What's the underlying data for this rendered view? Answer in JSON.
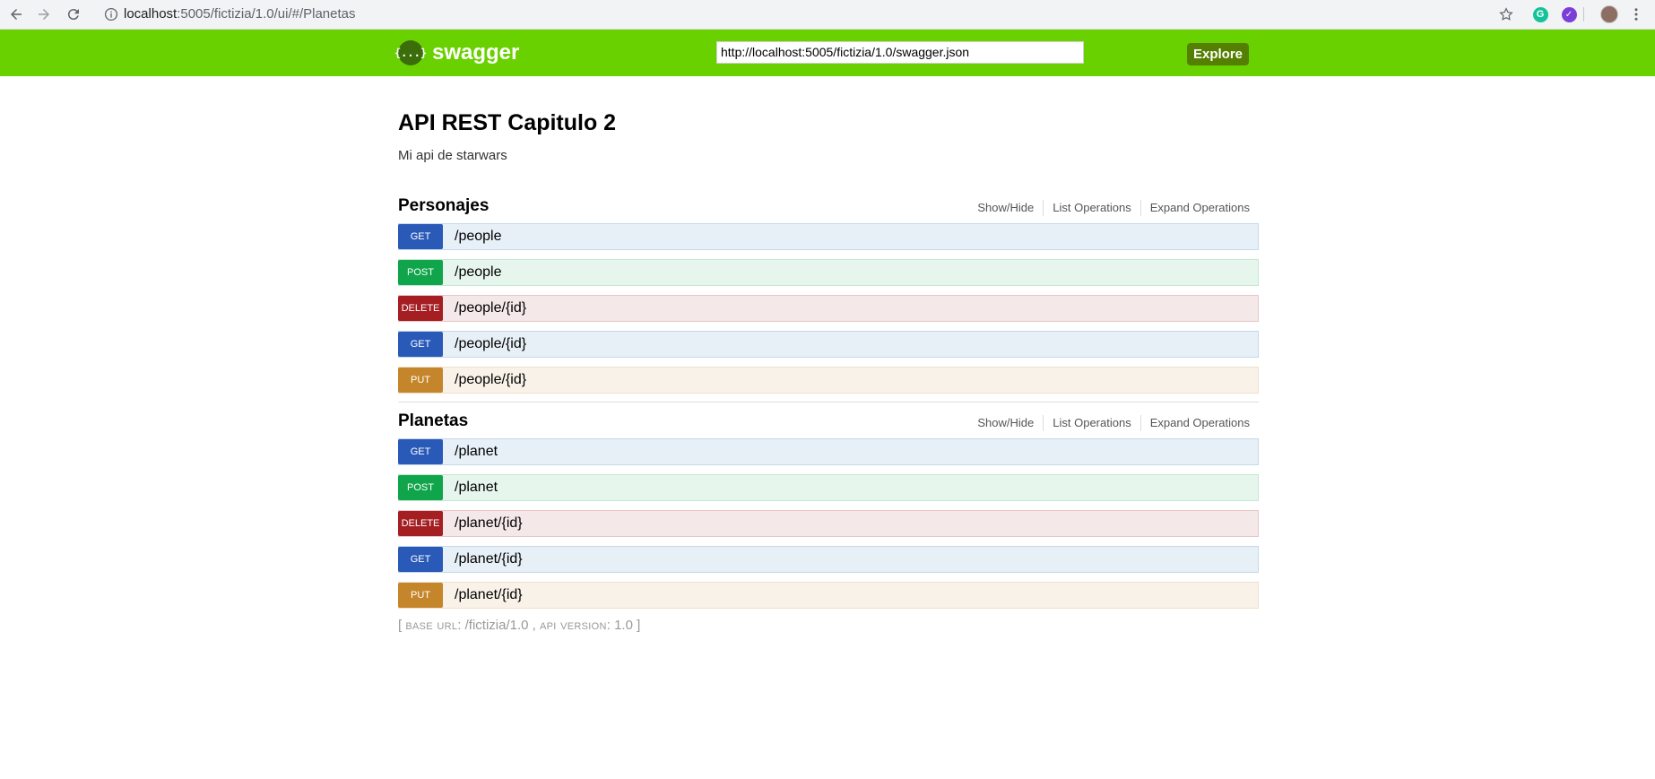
{
  "browser": {
    "url_host": "localhost",
    "url_path": ":5005/fictizia/1.0/ui/#/Planetas"
  },
  "header": {
    "logo_text": "swagger",
    "logo_icon": "{...}",
    "spec_url": "http://localhost:5005/fictizia/1.0/swagger.json",
    "explore_label": "Explore"
  },
  "info": {
    "title": "API REST Capitulo 2",
    "description": "Mi api de starwars"
  },
  "resources": [
    {
      "name": "Personajes",
      "ops_labels": [
        "Show/Hide",
        "List Operations",
        "Expand Operations"
      ],
      "operations": [
        {
          "method": "GET",
          "path": "/people"
        },
        {
          "method": "POST",
          "path": "/people"
        },
        {
          "method": "DELETE",
          "path": "/people/{id}"
        },
        {
          "method": "GET",
          "path": "/people/{id}"
        },
        {
          "method": "PUT",
          "path": "/people/{id}"
        }
      ]
    },
    {
      "name": "Planetas",
      "ops_labels": [
        "Show/Hide",
        "List Operations",
        "Expand Operations"
      ],
      "operations": [
        {
          "method": "GET",
          "path": "/planet"
        },
        {
          "method": "POST",
          "path": "/planet"
        },
        {
          "method": "DELETE",
          "path": "/planet/{id}"
        },
        {
          "method": "GET",
          "path": "/planet/{id}"
        },
        {
          "method": "PUT",
          "path": "/planet/{id}"
        }
      ]
    }
  ],
  "footer": {
    "open": "[",
    "base_url_label": "base url",
    "base_url": "/fictizia/1.0",
    "api_version_label": "api version",
    "api_version": "1.0",
    "close": "]"
  },
  "colors": {
    "header_bg": "#6ad100",
    "get": "#2a5ab8",
    "post": "#10a54a",
    "delete": "#a41e22",
    "put": "#c5862b"
  }
}
